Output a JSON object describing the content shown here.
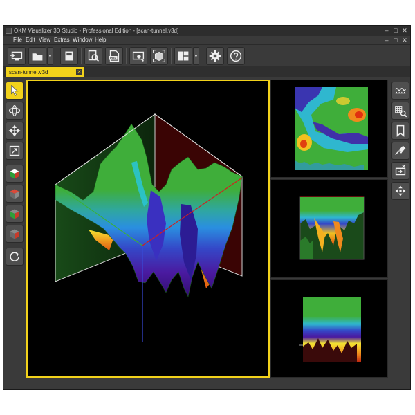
{
  "window": {
    "title": "OKM Visualizer 3D Studio - Professional Edition - [scan-tunnel.v3d]",
    "controls": {
      "minimize": "–",
      "restore": "□",
      "close": "✕"
    }
  },
  "menubar": {
    "items": [
      "File",
      "Edit",
      "View",
      "Extras",
      "Window",
      "Help"
    ],
    "mdi_controls": {
      "minimize": "–",
      "restore": "□",
      "close": "✕"
    }
  },
  "toolbar": {
    "buttons": [
      {
        "name": "import-scan",
        "icon": "monitor-import-icon"
      },
      {
        "name": "open-file",
        "icon": "folder-open-icon",
        "has_dropdown": true
      },
      {
        "name": "save-file",
        "icon": "disk-icon"
      },
      {
        "name": "print-preview",
        "icon": "magnifier-page-icon"
      },
      {
        "name": "export-pdf",
        "icon": "pdf-export-icon",
        "label": "PDF"
      },
      {
        "name": "screenshot",
        "icon": "camera-screen-icon"
      },
      {
        "name": "3d-view",
        "icon": "cube-select-icon"
      },
      {
        "name": "layout",
        "icon": "layout-grid-icon",
        "has_dropdown": true
      },
      {
        "name": "settings",
        "icon": "gear-icon"
      },
      {
        "name": "help",
        "icon": "question-icon"
      }
    ]
  },
  "tabs": [
    {
      "label": "scan-tunnel.v3d",
      "active": true,
      "close": "✕"
    }
  ],
  "left_tools": [
    {
      "name": "select",
      "icon": "arrow-cursor-icon",
      "active": true
    },
    {
      "name": "rotate",
      "icon": "rotate-3d-icon"
    },
    {
      "name": "move",
      "icon": "move-arrows-icon"
    },
    {
      "name": "zoom-box",
      "icon": "zoom-box-icon"
    },
    {
      "name": "view-iso",
      "icon": "cube-iso-icon"
    },
    {
      "name": "view-top",
      "icon": "cube-top-icon"
    },
    {
      "name": "view-side",
      "icon": "cube-side-icon"
    },
    {
      "name": "view-front",
      "icon": "cube-front-icon"
    },
    {
      "name": "reset-view",
      "icon": "reset-icon"
    }
  ],
  "right_tools": [
    {
      "name": "scan-line",
      "icon": "wave-ruler-icon"
    },
    {
      "name": "grid-zoom",
      "icon": "grid-magnifier-icon"
    },
    {
      "name": "bookmark",
      "icon": "bookmark-icon"
    },
    {
      "name": "measure",
      "icon": "measure-pen-icon"
    },
    {
      "name": "scan-export",
      "icon": "scan-export-icon"
    },
    {
      "name": "center-view",
      "icon": "crosshair-arrows-icon"
    }
  ],
  "colors": {
    "accent": "#f2d21b",
    "window_bg": "#3a3a3a",
    "viewport_bg": "#000000"
  }
}
